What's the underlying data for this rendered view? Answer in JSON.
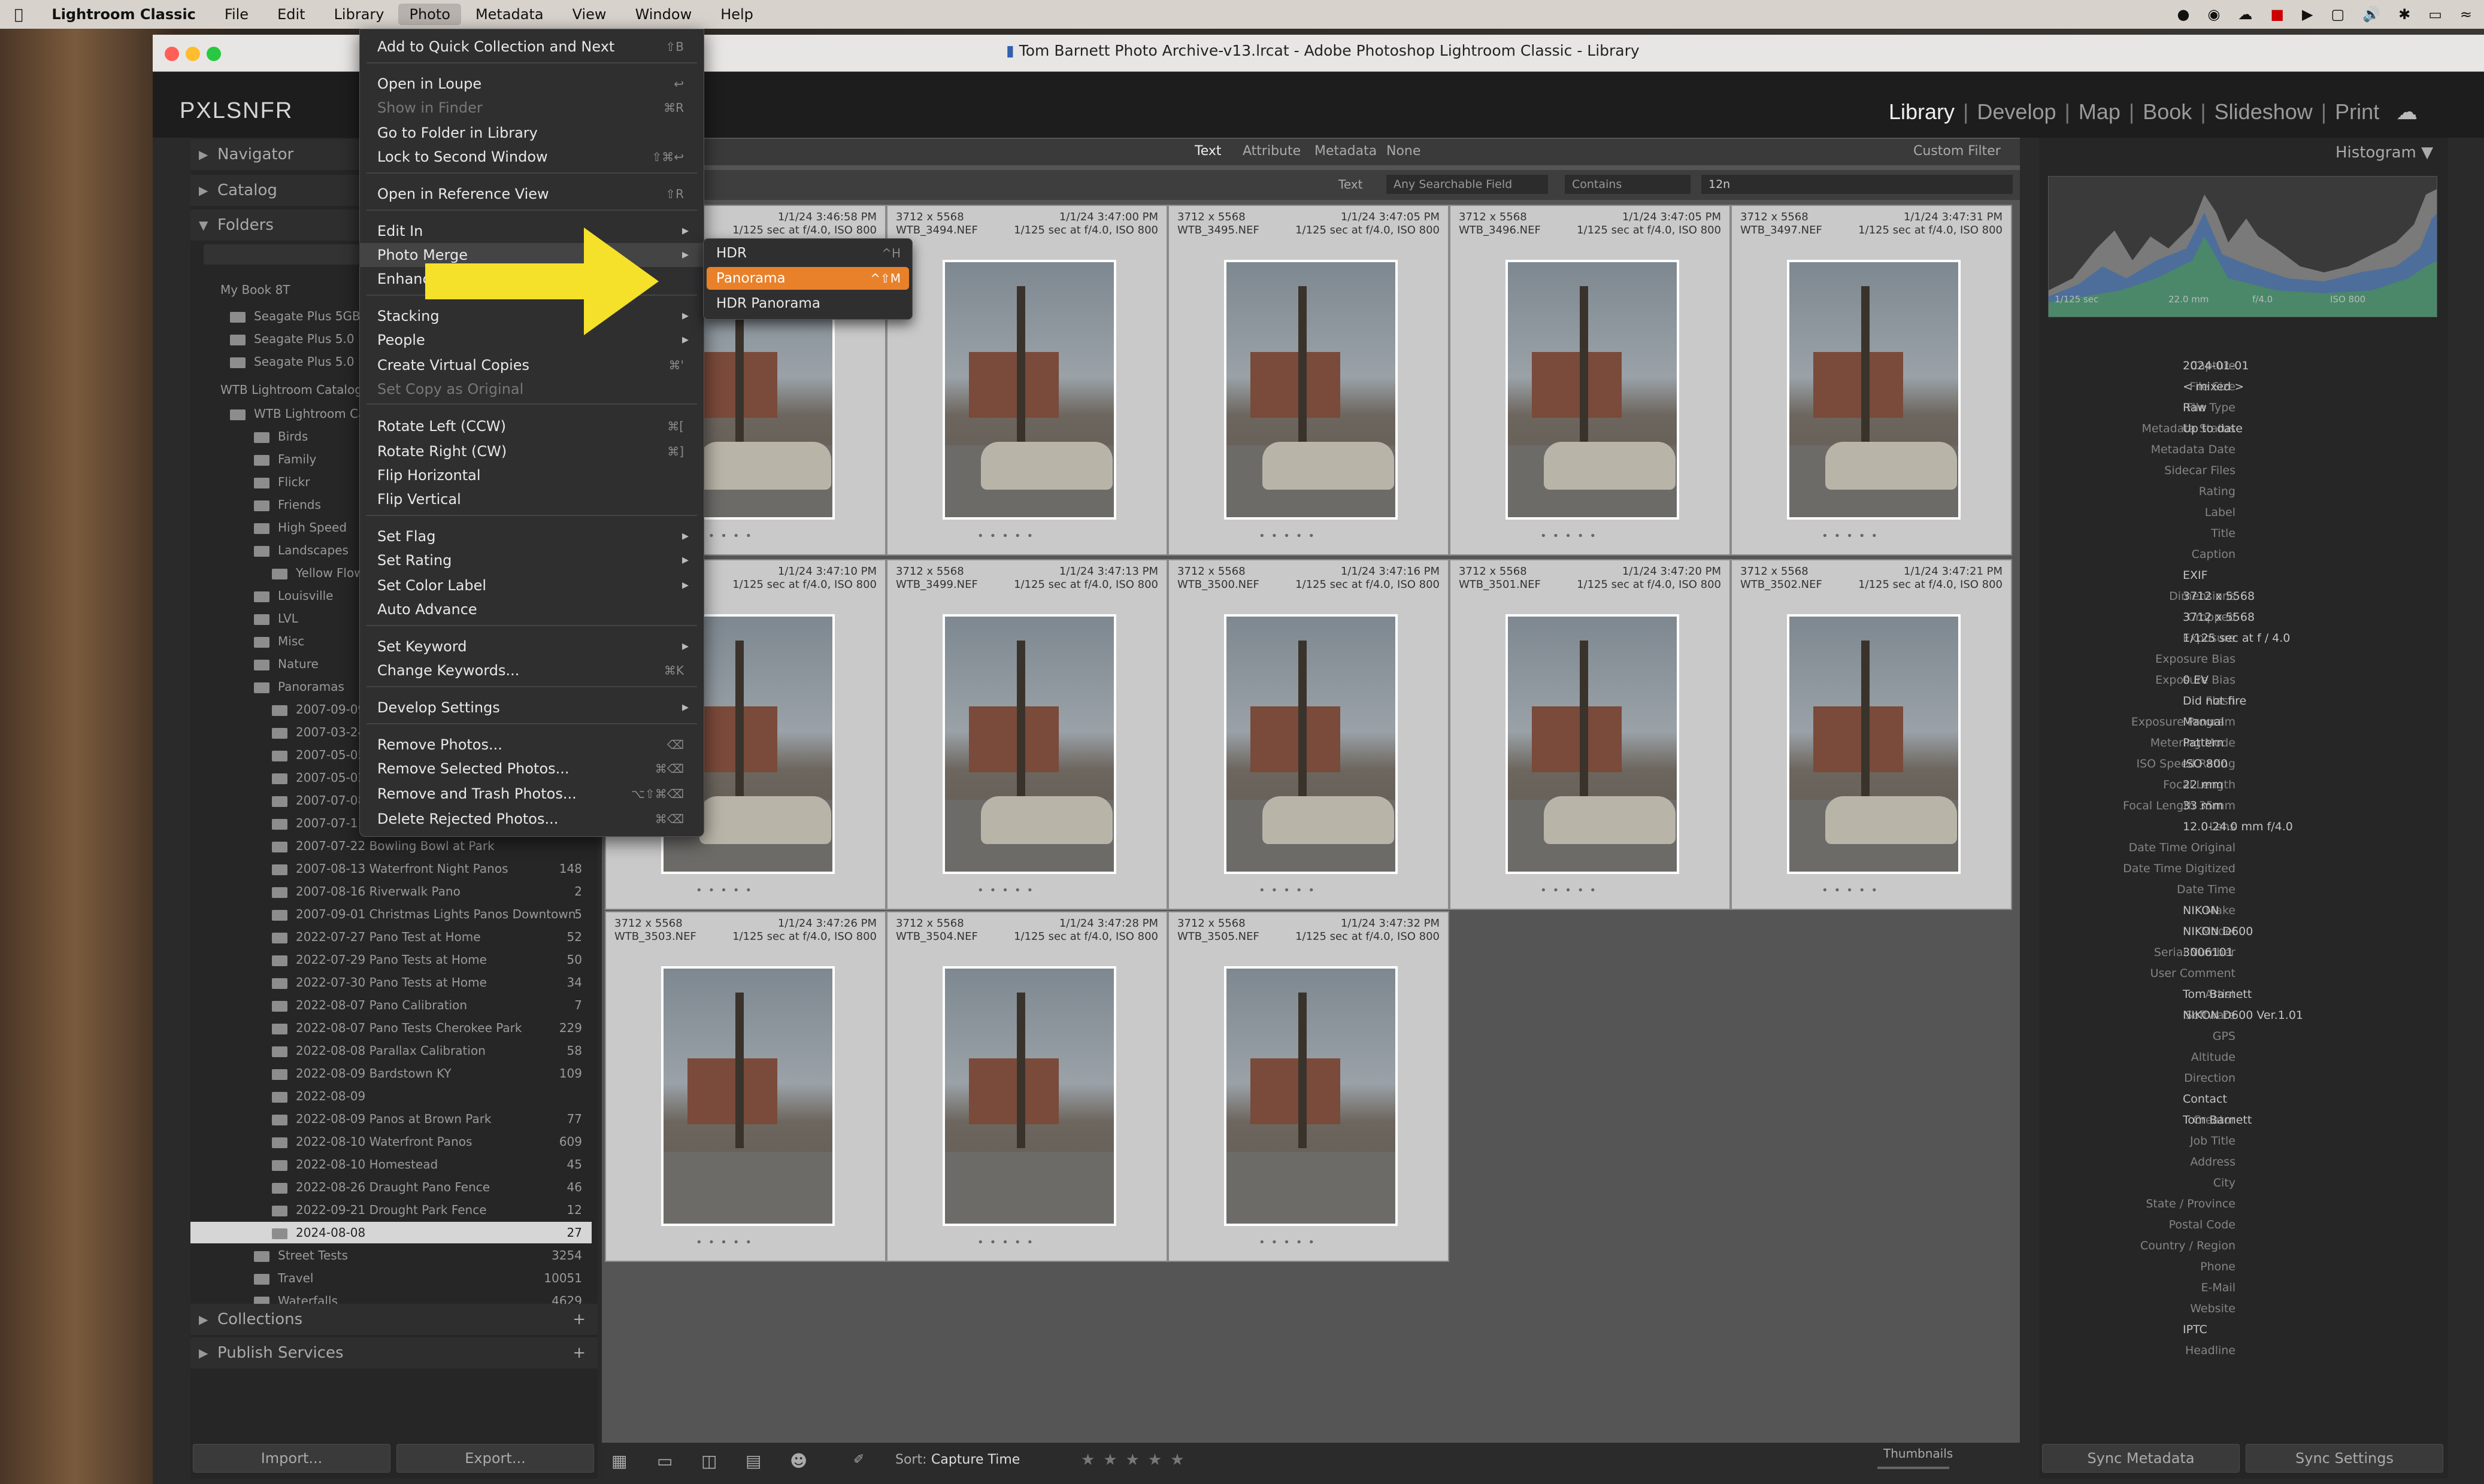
{
  "menubar": {
    "app": "Lightroom Classic",
    "items": [
      "File",
      "Edit",
      "Library",
      "Photo",
      "Metadata",
      "View",
      "Window",
      "Help"
    ],
    "active": "Photo"
  },
  "window": {
    "title": "Tom Barnett Photo Archive-v13.lrcat - Adobe Photoshop Lightroom Classic - Library",
    "brand": "PXLSNFR",
    "modules": [
      "Library",
      "Develop",
      "Map",
      "Book",
      "Slideshow",
      "Print"
    ],
    "active_module": "Library"
  },
  "left": {
    "navigator": "Navigator",
    "catalog": "Catalog",
    "folders": "Folders",
    "volume1": "My Book 8T",
    "volume2": "WTB Lightroom Catalog",
    "folders_list": [
      {
        "name": "Seagate Plus 5GB D",
        "count": ""
      },
      {
        "name": "Seagate Plus 5.0 Pd",
        "count": ""
      },
      {
        "name": "Seagate Plus 5.0 Pd",
        "count": ""
      },
      {
        "name": "WTB Lightroom Cat",
        "count": ""
      },
      {
        "name": "Birds",
        "count": ""
      },
      {
        "name": "Family",
        "count": ""
      },
      {
        "name": "Flickr",
        "count": ""
      },
      {
        "name": "Friends",
        "count": ""
      },
      {
        "name": "High Speed",
        "count": ""
      },
      {
        "name": "Landscapes",
        "count": ""
      },
      {
        "name": "Yellow Flow",
        "count": ""
      },
      {
        "name": "Louisville",
        "count": ""
      },
      {
        "name": "LVL",
        "count": ""
      },
      {
        "name": "Misc",
        "count": ""
      },
      {
        "name": "Nature",
        "count": ""
      },
      {
        "name": "Panoramas",
        "count": ""
      },
      {
        "name": "2007-09-09",
        "count": ""
      },
      {
        "name": "2007-03-24",
        "count": ""
      },
      {
        "name": "2007-05-05",
        "count": ""
      },
      {
        "name": "2007-05-02",
        "count": ""
      },
      {
        "name": "2007-07-08",
        "count": ""
      },
      {
        "name": "2007-07-11",
        "count": ""
      },
      {
        "name": "2007-07-22 Bowling Bowl at Park",
        "count": ""
      },
      {
        "name": "2007-08-13 Waterfront Night Panos",
        "count": "148"
      },
      {
        "name": "2007-08-16 Riverwalk Pano",
        "count": "2"
      },
      {
        "name": "2007-09-01 Christmas Lights Panos Downtown",
        "count": "5"
      },
      {
        "name": "2022-07-27 Pano Test at Home",
        "count": "52"
      },
      {
        "name": "2022-07-29 Pano Tests at Home",
        "count": "50"
      },
      {
        "name": "2022-07-30 Pano Tests at Home",
        "count": "34"
      },
      {
        "name": "2022-08-07 Pano Calibration",
        "count": "7"
      },
      {
        "name": "2022-08-07 Pano Tests Cherokee Park",
        "count": "229"
      },
      {
        "name": "2022-08-08 Parallax Calibration",
        "count": "58"
      },
      {
        "name": "2022-08-09 Bardstown KY",
        "count": "109"
      },
      {
        "name": "2022-08-09",
        "count": ""
      },
      {
        "name": "2022-08-09 Panos at Brown Park",
        "count": "77"
      },
      {
        "name": "2022-08-10 Waterfront Panos",
        "count": "609"
      },
      {
        "name": "2022-08-10 Homestead",
        "count": "45"
      },
      {
        "name": "2022-08-26 Draught Pano Fence",
        "count": "46"
      },
      {
        "name": "2022-09-21 Drought Park Fence",
        "count": "12"
      },
      {
        "name": "2024-08-08",
        "count": "27"
      },
      {
        "name": "Street Tests",
        "count": "3254"
      },
      {
        "name": "Travel",
        "count": "10051"
      },
      {
        "name": "Waterfalls",
        "count": "4629"
      }
    ],
    "collections": "Collections",
    "publish": "Publish Services",
    "import": "Import...",
    "export": "Export..."
  },
  "filter": {
    "tabs": [
      "Text",
      "Attribute",
      "Metadata",
      "None"
    ],
    "custom": "Custom Filter",
    "text_label": "Text",
    "field": "Any Searchable Field",
    "rule": "Contains",
    "query": "12n"
  },
  "grid": {
    "cells": [
      {
        "dims": "",
        "date": "1/1/24 3:46:58 PM",
        "file": "",
        "exp": "1/125 sec at f/4.0, ISO 800"
      },
      {
        "dims": "3712 x 5568",
        "date": "1/1/24 3:47:00 PM",
        "file": "WTB_3494.NEF",
        "exp": "1/125 sec at f/4.0, ISO 800"
      },
      {
        "dims": "3712 x 5568",
        "date": "1/1/24 3:47:05 PM",
        "file": "WTB_3495.NEF",
        "exp": "1/125 sec at f/4.0, ISO 800"
      },
      {
        "dims": "3712 x 5568",
        "date": "1/1/24 3:47:05 PM",
        "file": "WTB_3496.NEF",
        "exp": "1/125 sec at f/4.0, ISO 800"
      },
      {
        "dims": "3712 x 5568",
        "date": "1/1/24 3:47:31 PM",
        "file": "WTB_3497.NEF",
        "exp": "1/125 sec at f/4.0, ISO 800"
      },
      {
        "dims": "",
        "date": "1/1/24 3:47:10 PM",
        "file": "",
        "exp": "1/125 sec at f/4.0, ISO 800"
      },
      {
        "dims": "3712 x 5568",
        "date": "1/1/24 3:47:13 PM",
        "file": "WTB_3499.NEF",
        "exp": "1/125 sec at f/4.0, ISO 800"
      },
      {
        "dims": "3712 x 5568",
        "date": "1/1/24 3:47:16 PM",
        "file": "WTB_3500.NEF",
        "exp": "1/125 sec at f/4.0, ISO 800"
      },
      {
        "dims": "3712 x 5568",
        "date": "1/1/24 3:47:20 PM",
        "file": "WTB_3501.NEF",
        "exp": "1/125 sec at f/4.0, ISO 800"
      },
      {
        "dims": "3712 x 5568",
        "date": "1/1/24 3:47:21 PM",
        "file": "WTB_3502.NEF",
        "exp": "1/125 sec at f/4.0, ISO 800"
      },
      {
        "dims": "3712 x 5568",
        "date": "1/1/24 3:47:26 PM",
        "file": "WTB_3503.NEF",
        "exp": "1/125 sec at f/4.0, ISO 800"
      },
      {
        "dims": "3712 x 5568",
        "date": "1/1/24 3:47:28 PM",
        "file": "WTB_3504.NEF",
        "exp": "1/125 sec at f/4.0, ISO 800"
      },
      {
        "dims": "3712 x 5568",
        "date": "1/1/24 3:47:32 PM",
        "file": "WTB_3505.NEF",
        "exp": "1/125 sec at f/4.0, ISO 800"
      }
    ]
  },
  "toolbar": {
    "sort": "Sort:",
    "sort_value": "Capture Time",
    "thumbnails": "Thumbnails"
  },
  "right": {
    "histogram": "Histogram",
    "histo_info": [
      "1/125 sec",
      "22.0 mm",
      "f/4.0",
      "ISO 800"
    ],
    "meta": [
      {
        "k": "Capture",
        "v": "2024-01-01"
      },
      {
        "k": "File Size",
        "v": "< mixed >"
      },
      {
        "k": "File Type",
        "v": "Raw"
      },
      {
        "k": "Metadata Status",
        "v": "Up to date"
      },
      {
        "k": "Metadata Date",
        "v": ""
      },
      {
        "k": "Sidecar Files",
        "v": ""
      },
      {
        "k": "Rating",
        "v": ""
      },
      {
        "k": "Label",
        "v": ""
      },
      {
        "k": "Title",
        "v": ""
      },
      {
        "k": "Caption",
        "v": ""
      },
      {
        "k": "",
        "v": "EXIF"
      },
      {
        "k": "Dimensions",
        "v": "3712 x 5568"
      },
      {
        "k": "Cropped",
        "v": "3712 x 5568"
      },
      {
        "k": "Exposure",
        "v": "1/125 sec at f / 4.0"
      },
      {
        "k": "Exposure Bias",
        "v": ""
      },
      {
        "k": "Exposure Bias",
        "v": "0 EV"
      },
      {
        "k": "Flash",
        "v": "Did not fire"
      },
      {
        "k": "Exposure Program",
        "v": "Manual"
      },
      {
        "k": "Metering Mode",
        "v": "Pattern"
      },
      {
        "k": "ISO Speed Rating",
        "v": "ISO 800"
      },
      {
        "k": "Focal Length",
        "v": "22 mm"
      },
      {
        "k": "Focal Length 35mm",
        "v": "33 mm"
      },
      {
        "k": "Lens",
        "v": "12.0-24.0 mm f/4.0"
      },
      {
        "k": "Date Time Original",
        "v": ""
      },
      {
        "k": "Date Time Digitized",
        "v": ""
      },
      {
        "k": "Date Time",
        "v": ""
      },
      {
        "k": "Make",
        "v": "NIKON"
      },
      {
        "k": "Model",
        "v": "NIKON D600"
      },
      {
        "k": "Serial Number",
        "v": "3006101"
      },
      {
        "k": "User Comment",
        "v": ""
      },
      {
        "k": "Artist",
        "v": "Tom Barnett"
      },
      {
        "k": "Software",
        "v": "NIKON D600 Ver.1.01"
      },
      {
        "k": "GPS",
        "v": ""
      },
      {
        "k": "Altitude",
        "v": ""
      },
      {
        "k": "Direction",
        "v": ""
      },
      {
        "k": "",
        "v": "Contact"
      },
      {
        "k": "Creator",
        "v": "Tom Barnett"
      },
      {
        "k": "Job Title",
        "v": ""
      },
      {
        "k": "Address",
        "v": ""
      },
      {
        "k": "City",
        "v": ""
      },
      {
        "k": "State / Province",
        "v": ""
      },
      {
        "k": "Postal Code",
        "v": ""
      },
      {
        "k": "Country / Region",
        "v": ""
      },
      {
        "k": "Phone",
        "v": ""
      },
      {
        "k": "E-Mail",
        "v": ""
      },
      {
        "k": "Website",
        "v": ""
      },
      {
        "k": "",
        "v": "IPTC"
      },
      {
        "k": "Headline",
        "v": ""
      }
    ],
    "sync_meta": "Sync Metadata",
    "sync_settings": "Sync Settings"
  },
  "photo_menu": {
    "items": [
      {
        "label": "Add to Quick Collection and Next",
        "sc": "⇧B",
        "arrow": false,
        "dis": false
      },
      {
        "label": "Open in Loupe",
        "sc": "↩",
        "arrow": false,
        "dis": false
      },
      {
        "label": "Show in Finder",
        "sc": "⌘R",
        "arrow": false,
        "dis": true
      },
      {
        "label": "Go to Folder in Library",
        "sc": "",
        "arrow": false,
        "dis": false
      },
      {
        "label": "Lock to Second Window",
        "sc": "⇧⌘↩",
        "arrow": false,
        "dis": false
      },
      {
        "label": "Open in Reference View",
        "sc": "⇧R",
        "arrow": false,
        "dis": false
      },
      {
        "label": "Edit In",
        "sc": "",
        "arrow": true,
        "dis": false
      },
      {
        "label": "Photo Merge",
        "sc": "",
        "arrow": true,
        "dis": false
      },
      {
        "label": "Enhance...",
        "sc": "",
        "arrow": false,
        "dis": false
      },
      {
        "label": "Stacking",
        "sc": "",
        "arrow": true,
        "dis": false
      },
      {
        "label": "People",
        "sc": "",
        "arrow": true,
        "dis": false
      },
      {
        "label": "Create Virtual Copies",
        "sc": "⌘'",
        "arrow": false,
        "dis": false
      },
      {
        "label": "Set Copy as Original",
        "sc": "",
        "arrow": false,
        "dis": true
      },
      {
        "label": "Rotate Left (CCW)",
        "sc": "⌘[",
        "arrow": false,
        "dis": false
      },
      {
        "label": "Rotate Right (CW)",
        "sc": "⌘]",
        "arrow": false,
        "dis": false
      },
      {
        "label": "Flip Horizontal",
        "sc": "",
        "arrow": false,
        "dis": false
      },
      {
        "label": "Flip Vertical",
        "sc": "",
        "arrow": false,
        "dis": false
      },
      {
        "label": "Set Flag",
        "sc": "",
        "arrow": true,
        "dis": false
      },
      {
        "label": "Set Rating",
        "sc": "",
        "arrow": true,
        "dis": false
      },
      {
        "label": "Set Color Label",
        "sc": "",
        "arrow": true,
        "dis": false
      },
      {
        "label": "Auto Advance",
        "sc": "",
        "arrow": false,
        "dis": false
      },
      {
        "label": "Set Keyword",
        "sc": "",
        "arrow": true,
        "dis": false
      },
      {
        "label": "Change Keywords...",
        "sc": "⌘K",
        "arrow": false,
        "dis": false
      },
      {
        "label": "Develop Settings",
        "sc": "",
        "arrow": true,
        "dis": false
      },
      {
        "label": "Remove Photos...",
        "sc": "⌫",
        "arrow": false,
        "dis": false
      },
      {
        "label": "Remove Selected Photos...",
        "sc": "⌘⌫",
        "arrow": false,
        "dis": false
      },
      {
        "label": "Remove and Trash Photos...",
        "sc": "⌥⇧⌘⌫",
        "arrow": false,
        "dis": false
      },
      {
        "label": "Delete Rejected Photos...",
        "sc": "⌘⌫",
        "arrow": false,
        "dis": false
      }
    ]
  },
  "merge_submenu": {
    "items": [
      {
        "label": "HDR",
        "sc": "^H"
      },
      {
        "label": "Panorama",
        "sc": "^⇧M"
      },
      {
        "label": "HDR Panorama",
        "sc": ""
      }
    ],
    "highlighted": "Panorama"
  },
  "colors": {
    "accent_orange": "#e8812a",
    "annotation_arrow": "#f5e02a"
  }
}
